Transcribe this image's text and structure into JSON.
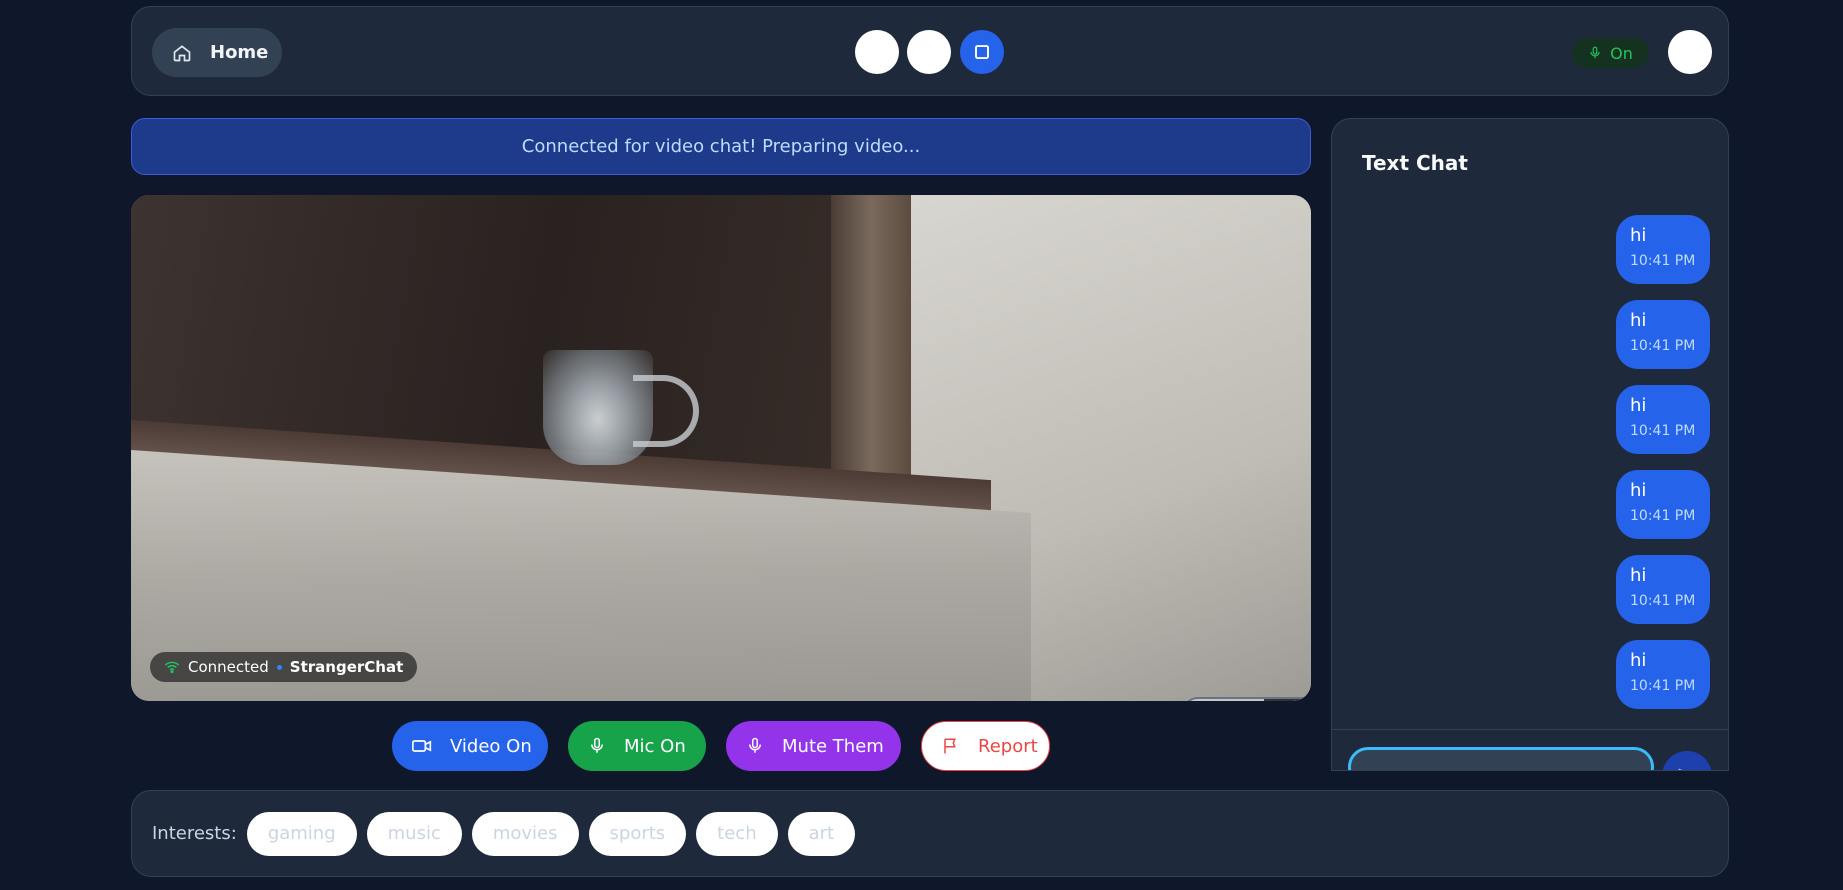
{
  "header": {
    "home_label": "Home",
    "mic_status": "On",
    "accent": "#2563eb"
  },
  "banner": {
    "text": "Connected for video chat! Preparing video..."
  },
  "video": {
    "status_text": "Connected",
    "brand_text": "StrangerChat"
  },
  "controls": {
    "video_label": "Video On",
    "mic_label": "Mic On",
    "mute_label": "Mute Them",
    "report_label": "Report"
  },
  "chat": {
    "title": "Text Chat",
    "messages": [
      {
        "text": "hi",
        "time": "10:41 PM"
      },
      {
        "text": "hi",
        "time": "10:41 PM"
      },
      {
        "text": "hi",
        "time": "10:41 PM"
      },
      {
        "text": "hi",
        "time": "10:41 PM"
      },
      {
        "text": "hi",
        "time": "10:41 PM"
      },
      {
        "text": "hi",
        "time": "10:41 PM"
      }
    ]
  },
  "interests": {
    "label": "Interests:",
    "tags": [
      "gaming",
      "music",
      "movies",
      "sports",
      "tech",
      "art"
    ]
  }
}
